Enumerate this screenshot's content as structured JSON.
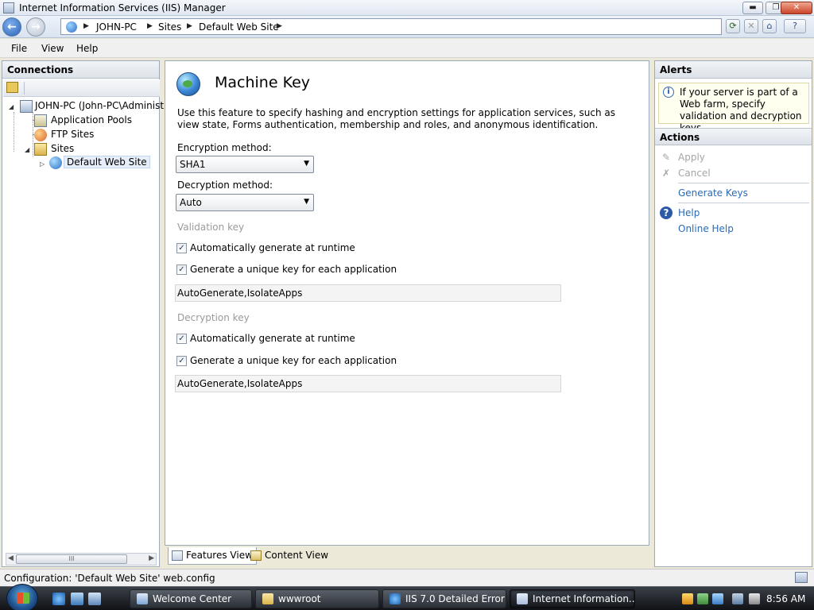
{
  "window": {
    "title": "Internet Information Services (IIS) Manager",
    "minimize_glyph": "▬",
    "maximize_glyph": "❐",
    "close_glyph": "✕"
  },
  "address": {
    "back_glyph": "←",
    "forward_glyph": "→",
    "breadcrumbs": [
      "JOHN-PC",
      "Sites",
      "Default Web Site"
    ],
    "sep_glyph": "▶",
    "refresh_glyph": "⟳",
    "stop_glyph": "✕",
    "home_glyph": "⌂",
    "help_glyph": "?"
  },
  "menu": [
    "File",
    "View",
    "Help"
  ],
  "connections": {
    "header": "Connections",
    "tree": {
      "server": "JOHN-PC (John-PC\\Administ",
      "app_pools": "Application Pools",
      "ftp_sites": "FTP Sites",
      "sites": "Sites",
      "default_site": "Default Web Site"
    },
    "scroll_glyph": "III"
  },
  "feature": {
    "title": "Machine Key",
    "description": "Use this feature to specify hashing and encryption settings for application services, such as view state, Forms authentication, membership and roles, and anonymous identification.",
    "encryption_label": "Encryption method:",
    "encryption_value": "SHA1",
    "decryption_label": "Decryption method:",
    "decryption_value": "Auto",
    "validation_section": "Validation key",
    "validation_auto": "Automatically generate at runtime",
    "validation_unique": "Generate a unique key for each application",
    "validation_key_value": "AutoGenerate,IsolateApps",
    "decryption_section": "Decryption key",
    "decryption_auto": "Automatically generate at runtime",
    "decryption_unique": "Generate a unique key for each application",
    "decryption_key_value": "AutoGenerate,IsolateApps",
    "check_glyph": "✓",
    "caret_glyph": "▼"
  },
  "view_tabs": {
    "features": "Features View",
    "content": "Content View"
  },
  "alerts": {
    "header": "Alerts",
    "message": "If your server is part of a Web farm, specify validation and decryption keys.",
    "info_glyph": "i"
  },
  "actions": {
    "header": "Actions",
    "apply": "Apply",
    "cancel": "Cancel",
    "generate_keys": "Generate Keys",
    "help": "Help",
    "online_help": "Online Help",
    "apply_glyph": "✎",
    "cancel_glyph": "✗",
    "help_glyph": "?"
  },
  "status": {
    "text": "Configuration: 'Default Web Site' web.config"
  },
  "taskbar": {
    "tasks": [
      "Welcome Center",
      "wwwroot",
      "IIS 7.0 Detailed Error ...",
      "Internet Information..."
    ],
    "clock": "8:56 AM"
  },
  "colors": {
    "accent": "#2a6bb4",
    "disabled": "#a5a5a5"
  }
}
